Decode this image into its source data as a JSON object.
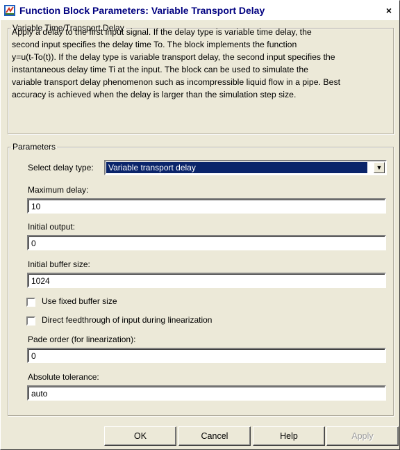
{
  "window": {
    "title": "Function Block Parameters: Variable Transport Delay",
    "close_glyph": "×",
    "icon": "simulink-block-icon"
  },
  "description_group": {
    "legend": "Variable Time/Transport Delay",
    "lines": [
      "Apply a delay to the first input signal.  If the delay type is variable time delay, the",
      "second input specifies the delay time To. The block implements the function",
      "y=u(t-To(t)). If the delay type is variable transport delay, the second input specifies the",
      "instantaneous delay time Ti at the input. The block can be used to simulate the",
      "variable transport delay phenomenon such as incompressible liquid flow in a pipe. Best",
      "accuracy is achieved when the delay is larger than the simulation step size."
    ]
  },
  "parameters_group": {
    "legend": "Parameters",
    "delay_type": {
      "label": "Select delay type:",
      "value": "Variable transport delay"
    },
    "max_delay": {
      "label": "Maximum delay:",
      "value": "10"
    },
    "initial_output": {
      "label": "Initial output:",
      "value": "0"
    },
    "initial_buffer": {
      "label": "Initial buffer size:",
      "value": "1024"
    },
    "fixed_buffer": {
      "label": "Use fixed buffer size",
      "checked": false
    },
    "direct_feedthrough": {
      "label": "Direct feedthrough of input during linearization",
      "checked": false
    },
    "pade_order": {
      "label": "Pade order (for linearization):",
      "value": "0"
    },
    "abs_tol": {
      "label": "Absolute tolerance:",
      "value": "auto"
    }
  },
  "buttons": {
    "ok": "OK",
    "cancel": "Cancel",
    "help": "Help",
    "apply": "Apply"
  },
  "colors": {
    "title_text": "#000080",
    "dialog_bg": "#ece9d8",
    "selection_bg": "#0a246a"
  }
}
